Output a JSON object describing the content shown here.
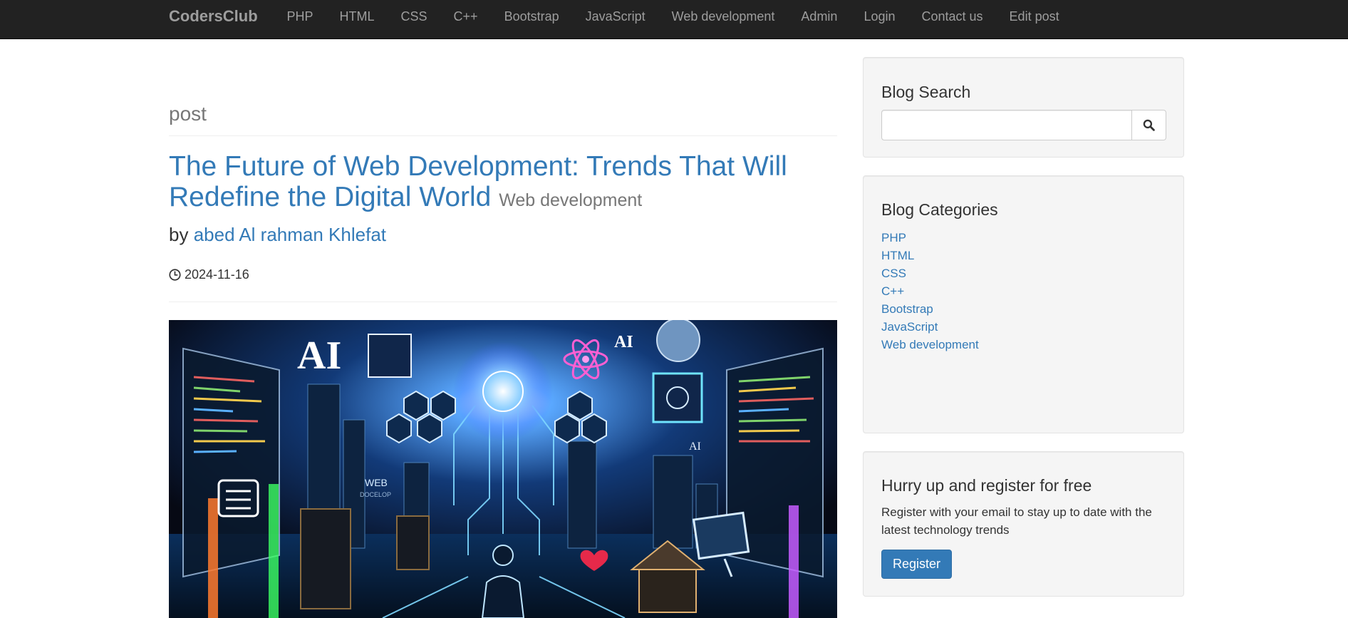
{
  "navbar": {
    "brand": "CodersClub",
    "items": [
      {
        "label": "PHP"
      },
      {
        "label": "HTML"
      },
      {
        "label": "CSS"
      },
      {
        "label": "C++"
      },
      {
        "label": "Bootstrap"
      },
      {
        "label": "JavaScript"
      },
      {
        "label": "Web development"
      },
      {
        "label": "Admin"
      },
      {
        "label": "Login"
      },
      {
        "label": "Contact us"
      },
      {
        "label": "Edit post"
      }
    ]
  },
  "main": {
    "page_header": "post",
    "post": {
      "title": "The Future of Web Development: Trends That Will Redefine the Digital World",
      "category": "Web development",
      "by_label": "by",
      "author": "abed Al rahman Khlefat",
      "date": "2024-11-16",
      "image_text": {
        "ai_large": "AI",
        "ai_small": "AI",
        "ai_tile": "AI",
        "web_label": "WEB",
        "web_sub": "DOCELOP"
      }
    }
  },
  "sidebar": {
    "search": {
      "title": "Blog Search",
      "placeholder": "",
      "value": ""
    },
    "categories": {
      "title": "Blog Categories",
      "items": [
        {
          "label": "PHP"
        },
        {
          "label": "HTML"
        },
        {
          "label": "CSS"
        },
        {
          "label": "C++"
        },
        {
          "label": "Bootstrap"
        },
        {
          "label": "JavaScript"
        },
        {
          "label": "Web development"
        }
      ]
    },
    "register": {
      "title": "Hurry up and register for free",
      "text": "Register with your email to stay up to date with the latest technology trends",
      "button": "Register"
    }
  },
  "colors": {
    "navbar_bg": "#222222",
    "link": "#337ab7",
    "muted": "#777777",
    "well_bg": "#f5f5f5",
    "primary_button": "#337ab7"
  },
  "icons": {
    "clock": "clock-icon",
    "search": "search-icon"
  }
}
